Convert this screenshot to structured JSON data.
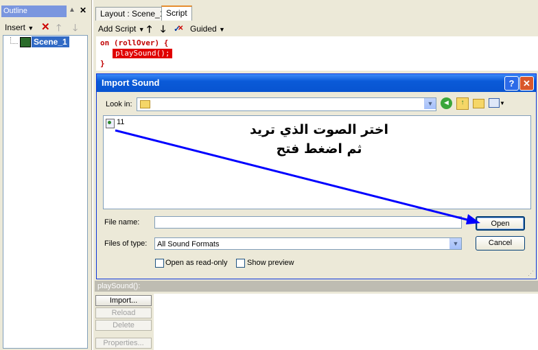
{
  "outline": {
    "title": "Outline",
    "ctrl": "▲",
    "close": "✕",
    "insert_label": "Insert",
    "tree_item": "Scene_1"
  },
  "tabs": [
    "Layout : Scene_1",
    "Script"
  ],
  "script_toolbar": {
    "add_script": "Add Script",
    "guided": "Guided"
  },
  "code": {
    "line1": "on (rollOver) {",
    "line2": "playSound();",
    "line3": "}"
  },
  "dialog": {
    "title": "Import Sound",
    "help": "?",
    "close": "✕",
    "look_in_label": "Look in:",
    "file_item": "11",
    "file_name_label": "File name:",
    "file_name_value": "",
    "files_of_type_label": "Files of type:",
    "files_of_type_value": "All Sound Formats",
    "open_label": "Open",
    "cancel_label": "Cancel",
    "readonly_label": "Open as read-only",
    "preview_label": "Show preview"
  },
  "annotation": {
    "line1": "اختر الصوت الذي تريد",
    "line2": "ثم اضغط فتح"
  },
  "bottom": {
    "header": "playSound():",
    "import": "Import...",
    "reload": "Reload",
    "delete": "Delete",
    "properties": "Properties..."
  },
  "colors": {
    "title_blue": "#0a5ad8",
    "code_red": "#e00000",
    "arrow_blue": "#0000ff"
  }
}
